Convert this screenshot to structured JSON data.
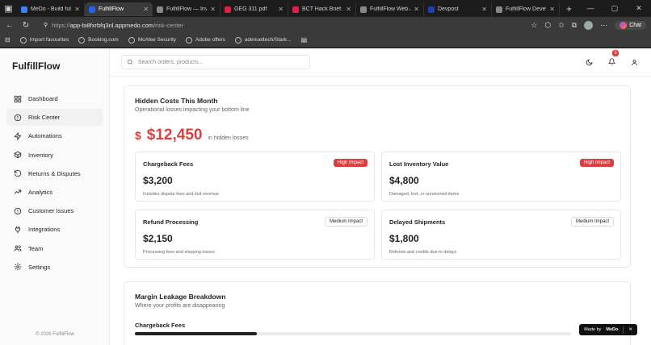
{
  "browser": {
    "tabs": [
      {
        "label": "MeDo - Build full-st",
        "color": "#3b82f6",
        "active": false
      },
      {
        "label": "FulfillFlow",
        "color": "#2563eb",
        "active": true
      },
      {
        "label": "FulfillFlow — Inven",
        "color": "#888888",
        "active": false
      },
      {
        "label": "GEG 311.pdf",
        "color": "#e11d48",
        "active": false
      },
      {
        "label": "BCT Hack Brief.pdf",
        "color": "#e11d48",
        "active": false
      },
      {
        "label": "FulfillFlow Web Ap",
        "color": "#888888",
        "active": false
      },
      {
        "label": "Devpost",
        "color": "#1e40af",
        "active": false
      },
      {
        "label": "FulfillFlow Develop",
        "color": "#888888",
        "active": false
      }
    ],
    "url_prefix": "https://",
    "url_host": "app-bi8fxrbfq3nl.appmedo.com",
    "url_path": "/risk-center",
    "chat_label": "Chat",
    "favorites": [
      "Import favourites",
      "Booking.com",
      "McAfee Security",
      "Adobe offers",
      "adenueltech/Stark..."
    ]
  },
  "app": {
    "brand": "FulfillFlow",
    "nav": [
      {
        "label": "Dashboard",
        "icon": "grid-icon",
        "active": false
      },
      {
        "label": "Risk Center",
        "icon": "alert-circle-icon",
        "active": true
      },
      {
        "label": "Automations",
        "icon": "zap-icon",
        "active": false
      },
      {
        "label": "Inventory",
        "icon": "package-icon",
        "active": false
      },
      {
        "label": "Returns & Disputes",
        "icon": "rotate-ccw-icon",
        "active": false
      },
      {
        "label": "Analytics",
        "icon": "trending-up-icon",
        "active": false
      },
      {
        "label": "Customer Issues",
        "icon": "alert-info-icon",
        "active": false
      },
      {
        "label": "Integrations",
        "icon": "plug-icon",
        "active": false
      },
      {
        "label": "Team",
        "icon": "users-icon",
        "active": false
      },
      {
        "label": "Settings",
        "icon": "settings-icon",
        "active": false
      }
    ],
    "footer": "© 2026 FulfillFlow",
    "search_placeholder": "Search orders, products...",
    "notification_count": "3"
  },
  "hidden_costs": {
    "title": "Hidden Costs This Month",
    "subtitle": "Operational losses impacting your bottom line",
    "currency_symbol": "$",
    "total": "$12,450",
    "total_caption": "in hidden losses",
    "items": [
      {
        "name": "Chargeback Fees",
        "value": "$3,200",
        "desc": "Includes dispute fees and lost revenue",
        "impact": "High Impact",
        "level": "high"
      },
      {
        "name": "Lost Inventory Value",
        "value": "$4,800",
        "desc": "Damaged, lost, or unreturned items",
        "impact": "High Impact",
        "level": "high"
      },
      {
        "name": "Refund Processing",
        "value": "$2,150",
        "desc": "Processing fees and shipping losses",
        "impact": "Medium Impact",
        "level": "medium"
      },
      {
        "name": "Delayed Shipments",
        "value": "$1,800",
        "desc": "Refunds and credits due to delays",
        "impact": "Medium Impact",
        "level": "medium"
      }
    ]
  },
  "margin_leakage": {
    "title": "Margin Leakage Breakdown",
    "subtitle": "Where your profits are disappearing",
    "rows": [
      {
        "label": "Chargeback Fees",
        "fraction": 0.28
      }
    ]
  },
  "made_by": {
    "prefix": "Made by",
    "brand": "MeDo"
  },
  "colors": {
    "danger": "#dc3d3d",
    "text": "#222222",
    "muted": "#666666"
  }
}
